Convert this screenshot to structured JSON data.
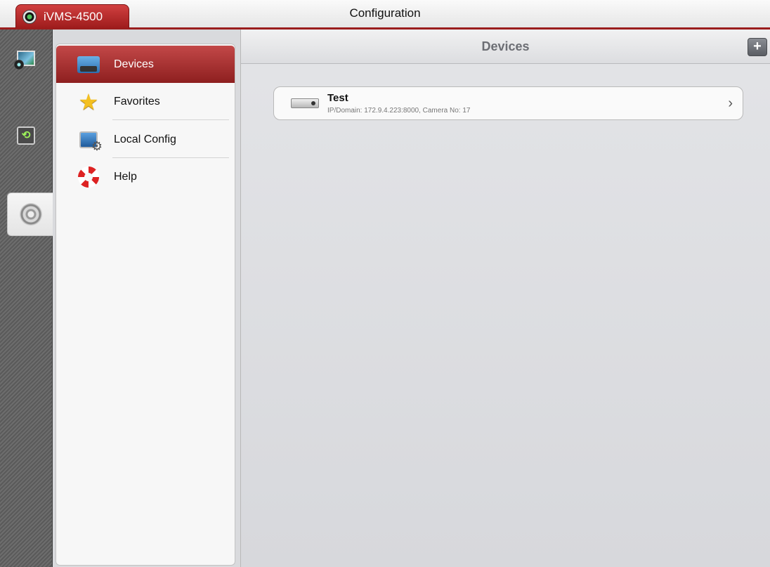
{
  "app": {
    "name": "iVMS-4500",
    "window_title": "Configuration"
  },
  "rail": {
    "items": [
      {
        "name": "live-view",
        "icon": "live-view-icon"
      },
      {
        "name": "playback",
        "icon": "playback-icon"
      },
      {
        "name": "configuration",
        "icon": "gear-icon",
        "selected": true
      }
    ]
  },
  "sidebar": {
    "items": [
      {
        "label": "Devices",
        "icon": "devices-folder-icon",
        "active": true
      },
      {
        "label": "Favorites",
        "icon": "star-icon"
      },
      {
        "label": "Local Config",
        "icon": "local-config-icon"
      },
      {
        "label": "Help",
        "icon": "lifebuoy-icon"
      }
    ]
  },
  "main": {
    "title": "Devices",
    "add_label": "+",
    "devices": [
      {
        "name": "Test",
        "detail": "IP/Domain: 172.9.4.223:8000, Camera No: 17"
      }
    ]
  },
  "colors": {
    "accent": "#9a1d1d",
    "active_item": "#b03434",
    "rail_bg": "#626262"
  }
}
